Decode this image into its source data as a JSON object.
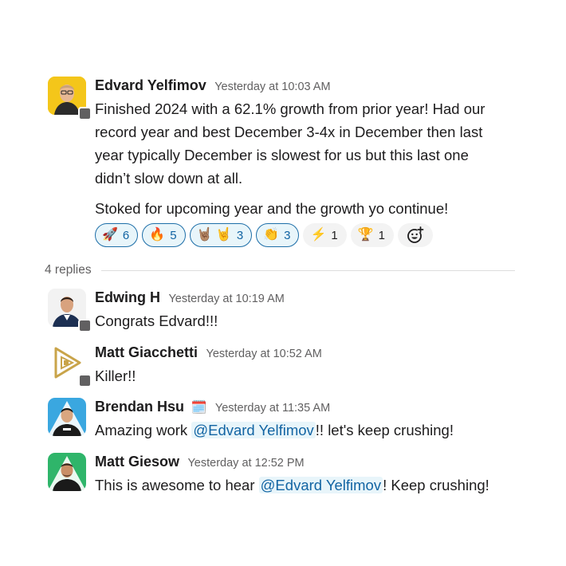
{
  "thread": {
    "parent": {
      "author": "Edvard Yelfimov",
      "timestamp": "Yesterday at 10:03 AM",
      "paragraph1_lines": [
        "Finished 2024 with a 62.1% growth from prior year! Had our",
        "record year and best December 3-4x in December then last",
        "year typically December is slowest for us but this last one",
        "didn’t slow down at all."
      ],
      "paragraph2": "Stoked for upcoming year and the growth yo continue!",
      "reactions": [
        {
          "emoji": "🚀",
          "count": "6",
          "reacted": true
        },
        {
          "emoji": "🔥",
          "count": "5",
          "reacted": true
        },
        {
          "emoji": "🤘🏽 🤘",
          "count": "3",
          "reacted": true
        },
        {
          "emoji": "👏",
          "count": "3",
          "reacted": true
        },
        {
          "emoji": "⚡",
          "count": "1",
          "reacted": false
        },
        {
          "emoji": "🏆",
          "count": "1",
          "reacted": false
        }
      ]
    },
    "replies_label": "4 replies",
    "replies": [
      {
        "author": "Edwing H",
        "timestamp": "Yesterday at 10:19 AM",
        "text": "Congrats Edvard!!!"
      },
      {
        "author": "Matt Giacchetti",
        "timestamp": "Yesterday at 10:52 AM",
        "text": "Killer!!"
      },
      {
        "author": "Brendan Hsu",
        "status_emoji": "🗓️",
        "timestamp": "Yesterday at 11:35 AM",
        "text_before": "Amazing work ",
        "mention": "@Edvard Yelfimov",
        "text_after": "!! let's keep crushing!"
      },
      {
        "author": "Matt Giesow",
        "timestamp": "Yesterday at 12:52 PM",
        "text_before": "This is awesome to hear ",
        "mention": "@Edvard Yelfimov",
        "text_after": "! Keep crushing!"
      }
    ]
  },
  "icons": {
    "add_reaction": "add-reaction-icon",
    "presence": "presence-indicator"
  },
  "colors": {
    "mention_text": "#1264a3",
    "mention_bg": "#e8f5fa",
    "reaction_border": "#1d6ea8",
    "timestamp": "#616061"
  }
}
